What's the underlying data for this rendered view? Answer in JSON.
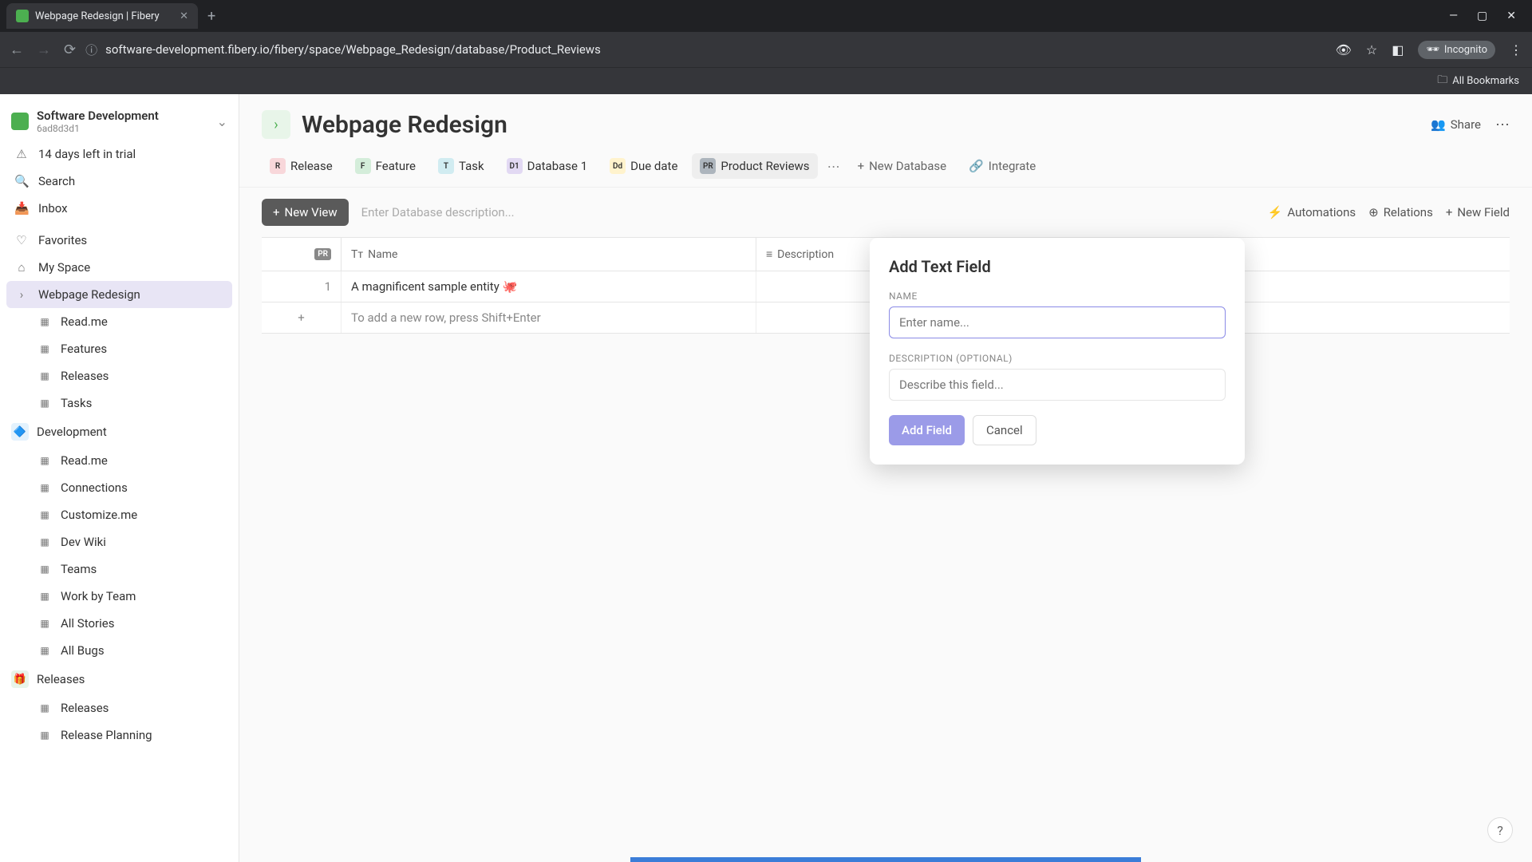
{
  "browser": {
    "tab_title": "Webpage Redesign | Fibery",
    "url": "software-development.fibery.io/fibery/space/Webpage_Redesign/database/Product_Reviews",
    "incognito_label": "Incognito",
    "bookmarks_label": "All Bookmarks"
  },
  "workspace": {
    "name": "Software Development",
    "id": "6ad8d3d1",
    "trial_notice": "14 days left in trial"
  },
  "sidebar": {
    "search": "Search",
    "inbox": "Inbox",
    "favorites": "Favorites",
    "my_space": "My Space",
    "selected": "Webpage Redesign",
    "wr_children": [
      "Read.me",
      "Features",
      "Releases",
      "Tasks"
    ],
    "dev_label": "Development",
    "dev_children": [
      "Read.me",
      "Connections",
      "Customize.me",
      "Dev Wiki",
      "Teams",
      "Work by Team",
      "All Stories",
      "All Bugs"
    ],
    "releases_label": "Releases",
    "rel_children": [
      "Releases",
      "Release Planning"
    ]
  },
  "page": {
    "title": "Webpage Redesign",
    "share": "Share"
  },
  "db_tabs": [
    {
      "chip": "R",
      "label": "Release",
      "color": "#f8d7da"
    },
    {
      "chip": "F",
      "label": "Feature",
      "color": "#d4edda"
    },
    {
      "chip": "T",
      "label": "Task",
      "color": "#d1ecf1"
    },
    {
      "chip": "D1",
      "label": "Database 1",
      "color": "#e2d9f3"
    },
    {
      "chip": "Dd",
      "label": "Due date",
      "color": "#fff3cd"
    },
    {
      "chip": "PR",
      "label": "Product Reviews",
      "color": "#adb5bd"
    }
  ],
  "db_actions": {
    "new_db": "New Database",
    "integrate": "Integrate"
  },
  "toolbar": {
    "new_view": "New View",
    "desc_placeholder": "Enter Database description...",
    "automations": "Automations",
    "relations": "Relations",
    "new_field": "New Field"
  },
  "table": {
    "col_name": "Name",
    "col_desc": "Description",
    "pr_chip": "PR",
    "rows": [
      {
        "n": "1",
        "name": "A magnificent sample entity 🐙"
      }
    ],
    "add_hint": "To add a new row, press Shift+Enter"
  },
  "popup": {
    "title": "Add Text Field",
    "name_label": "NAME",
    "name_placeholder": "Enter name...",
    "desc_label": "DESCRIPTION (OPTIONAL)",
    "desc_placeholder": "Describe this field...",
    "add_btn": "Add Field",
    "cancel_btn": "Cancel"
  }
}
